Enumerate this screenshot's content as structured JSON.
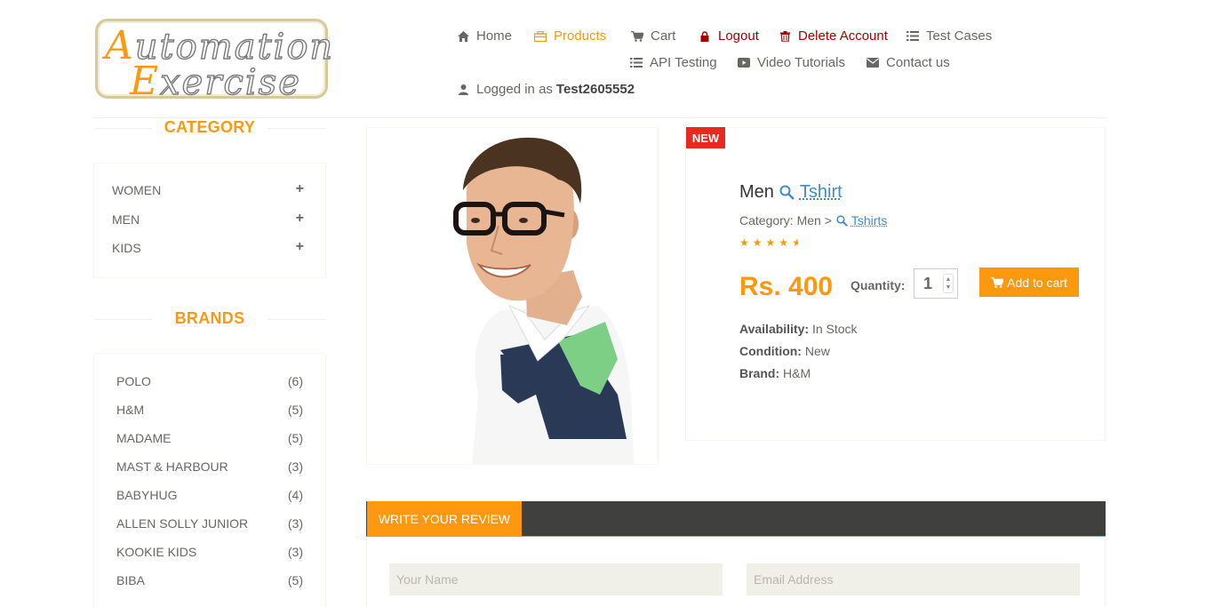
{
  "logo": {
    "line1_cap": "A",
    "line1_rest": "utomation",
    "line2_cap": "E",
    "line2_rest": "xercise"
  },
  "nav": {
    "home": "Home",
    "products": "Products",
    "cart": "Cart",
    "logout": "Logout",
    "delete_account": "Delete Account",
    "test_cases": "Test Cases",
    "api_testing": "API Testing",
    "video_tutorials": "Video Tutorials",
    "contact_us": "Contact us",
    "logged_in_prefix": "Logged in as",
    "logged_in_user": "Test2605552"
  },
  "colors": {
    "accent": "#fe980f",
    "danger": "#a30000",
    "link": "#428bca",
    "badge": "#e62b1e"
  },
  "sidebar": {
    "category_title": "CATEGORY",
    "categories": [
      "WOMEN",
      "MEN",
      "KIDS"
    ],
    "brands_title": "BRANDS",
    "brands": [
      {
        "name": "POLO",
        "count": "(6)"
      },
      {
        "name": "H&M",
        "count": "(5)"
      },
      {
        "name": "MADAME",
        "count": "(5)"
      },
      {
        "name": "MAST & HARBOUR",
        "count": "(3)"
      },
      {
        "name": "BABYHUG",
        "count": "(4)"
      },
      {
        "name": "ALLEN SOLLY JUNIOR",
        "count": "(3)"
      },
      {
        "name": "KOOKIE KIDS",
        "count": "(3)"
      },
      {
        "name": "BIBA",
        "count": "(5)"
      }
    ]
  },
  "product": {
    "badge": "NEW",
    "name_prefix": "Men",
    "name_link": "Tshirt",
    "category_prefix": "Category: Men >",
    "category_link": "Tshirts",
    "rating": 4.5,
    "price": "Rs. 400",
    "quantity_label": "Quantity:",
    "quantity": "1",
    "add_to_cart": "Add to cart",
    "availability_label": "Availability:",
    "availability": "In Stock",
    "condition_label": "Condition:",
    "condition": "New",
    "brand_label": "Brand:",
    "brand": "H&M"
  },
  "review": {
    "tab_label": "WRITE YOUR REVIEW",
    "name_placeholder": "Your Name",
    "email_placeholder": "Email Address"
  }
}
